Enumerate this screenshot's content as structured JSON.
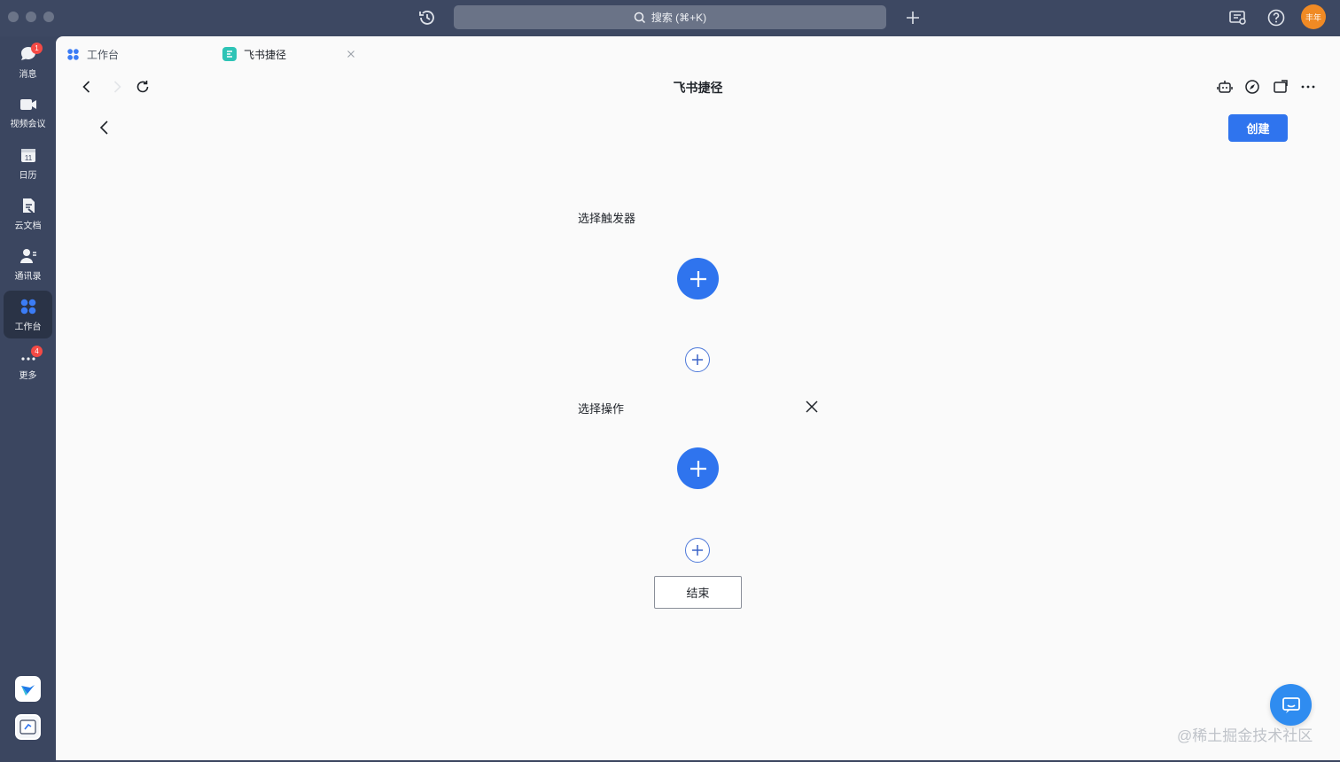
{
  "window": {
    "search_placeholder": "搜索 (⌘+K)",
    "avatar_text": "丰年"
  },
  "sidebar": {
    "items": [
      {
        "label": "消息",
        "icon": "chat-bubble-icon",
        "badge": "1"
      },
      {
        "label": "视频会议",
        "icon": "video-camera-icon"
      },
      {
        "label": "日历",
        "icon": "calendar-icon",
        "date": "11"
      },
      {
        "label": "云文档",
        "icon": "cloud-doc-icon"
      },
      {
        "label": "通讯录",
        "icon": "contacts-icon"
      },
      {
        "label": "工作台",
        "icon": "workspace-grid-icon",
        "active": true
      },
      {
        "label": "更多",
        "icon": "more-dots-icon",
        "badge": "4"
      }
    ],
    "bottom_apps": [
      "blue-app-icon",
      "white-app-icon"
    ]
  },
  "tabs": [
    {
      "label": "工作台",
      "icon": "workspace-grid-icon"
    },
    {
      "label": "飞书捷径",
      "icon": "shortcut-app-icon",
      "closable": true
    }
  ],
  "page": {
    "title": "飞书捷径",
    "create_label": "创建",
    "trigger_label": "选择触发器",
    "action_label": "选择操作",
    "end_label": "结束",
    "watermark": "@稀土掘金技术社区"
  },
  "colors": {
    "accent": "#2f74ee",
    "titlebar": "#3d4862",
    "sidebar": "#3b4660",
    "avatar": "#f08a24",
    "badge": "#f54a45"
  }
}
